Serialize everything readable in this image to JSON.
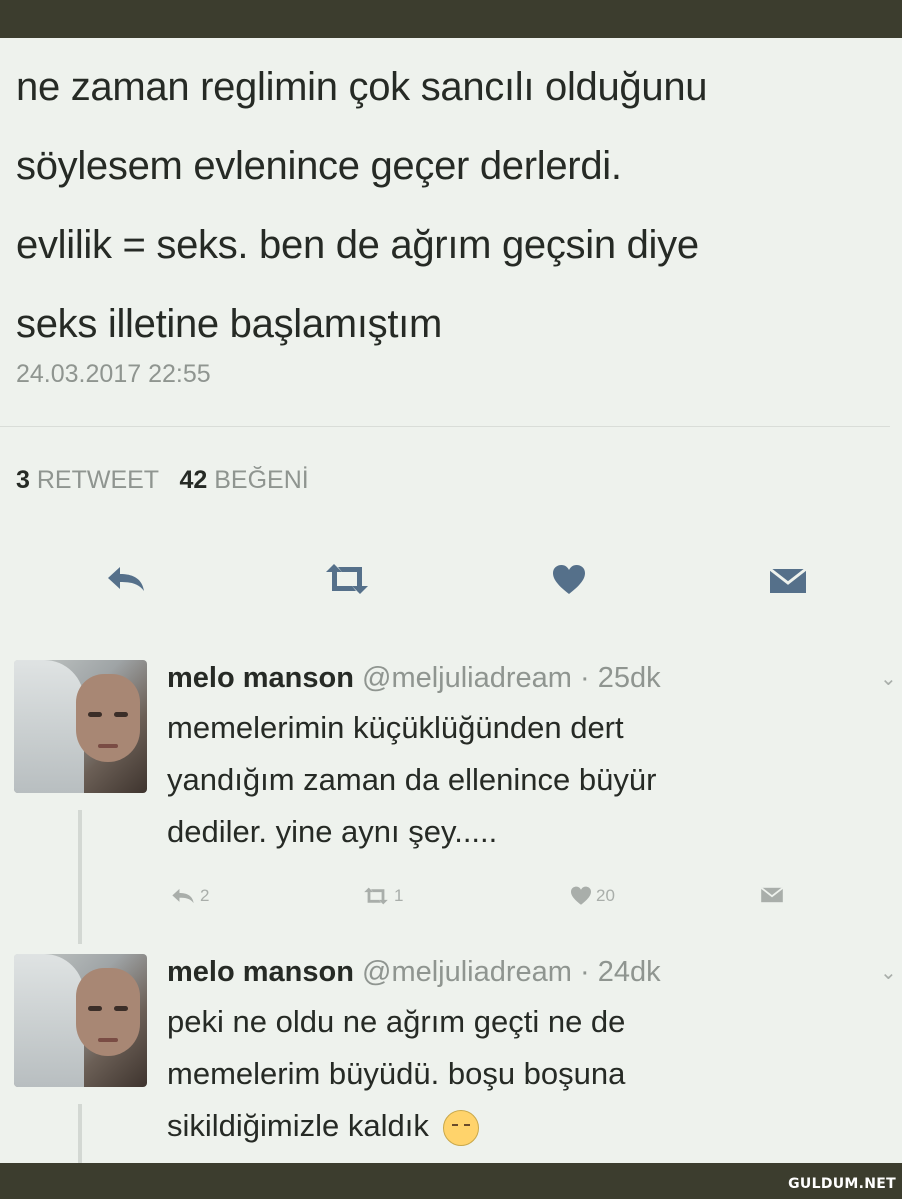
{
  "tweet": {
    "lines": [
      "ne zaman reglimin çok sancılı olduğunu",
      "söylesem evlenince geçer derlerdi.",
      "evlilik = seks. ben de ağrım geçsin diye",
      "seks illetine başlamıştım"
    ],
    "timestamp": "24.03.2017 22:55",
    "retweet_count": "3",
    "retweet_label": "RETWEET",
    "like_count": "42",
    "like_label": "BEĞENİ"
  },
  "replies": [
    {
      "name": "melo manson",
      "handle": "@meljuliadream",
      "time": "· 25dk",
      "lines": [
        "memelerimin küçüklüğünden dert",
        "yandığım zaman da ellenince büyür",
        "dediler. yine aynı şey....."
      ],
      "reply_count": "2",
      "retweet_count": "1",
      "like_count": "20"
    },
    {
      "name": "melo manson",
      "handle": "@meljuliadream",
      "time": "· 24dk",
      "lines": [
        "peki ne oldu ne ağrım geçti ne de",
        "memelerim büyüdü. boşu boşuna",
        "sikildiğimizle kaldık"
      ]
    }
  ],
  "watermark": "GULDUM.NET",
  "colors": {
    "background": "#eef2ed",
    "icon": "#55708a",
    "muted": "#8f9590"
  },
  "icons": [
    "reply-icon",
    "retweet-icon",
    "heart-icon",
    "message-icon",
    "chevron-down-icon",
    "unamused-face-emoji"
  ]
}
